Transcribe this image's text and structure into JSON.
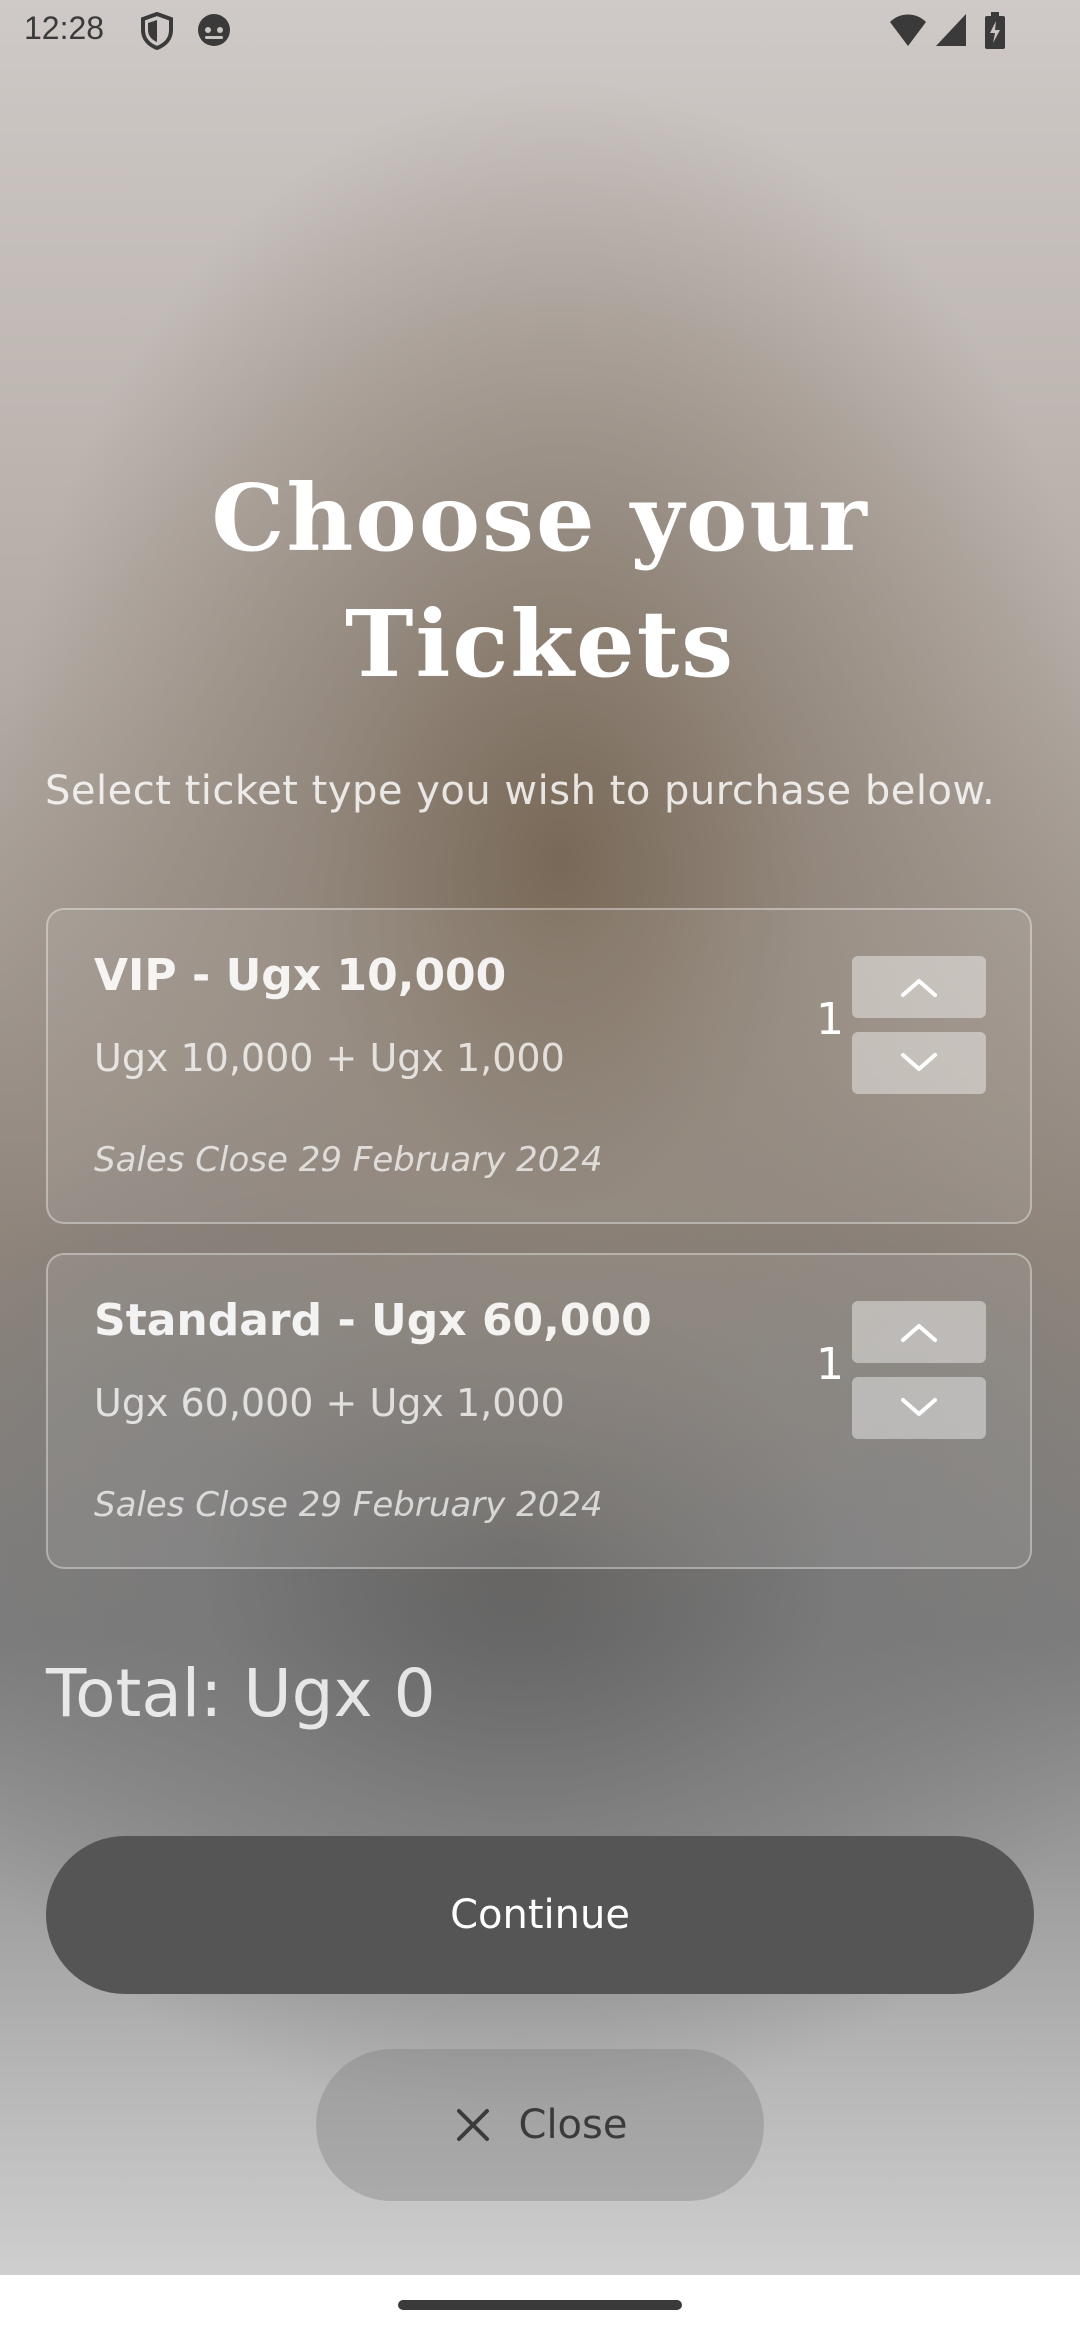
{
  "status_bar": {
    "time": "12:28",
    "icons": [
      "shield-icon",
      "android-face-icon",
      "wifi-icon",
      "signal-icon",
      "battery-charging-icon"
    ]
  },
  "header": {
    "title_line1": "Choose your",
    "title_line2": "Tickets",
    "subtitle": "Select ticket type you wish to purchase below."
  },
  "tickets": [
    {
      "name": "VIP - Ugx 10,000",
      "price_detail": "Ugx 10,000 + Ugx 1,000",
      "sales_close": "Sales Close 29 February 2024",
      "quantity": "1"
    },
    {
      "name": "Standard - Ugx 60,000",
      "price_detail": "Ugx 60,000 + Ugx 1,000",
      "sales_close": "Sales Close 29 February 2024",
      "quantity": "1"
    }
  ],
  "summary": {
    "total": "Total: Ugx 0"
  },
  "actions": {
    "continue_label": "Continue",
    "close_label": "Close"
  },
  "colors": {
    "continue_bg": "#555555",
    "text_primary": "#ffffff"
  }
}
